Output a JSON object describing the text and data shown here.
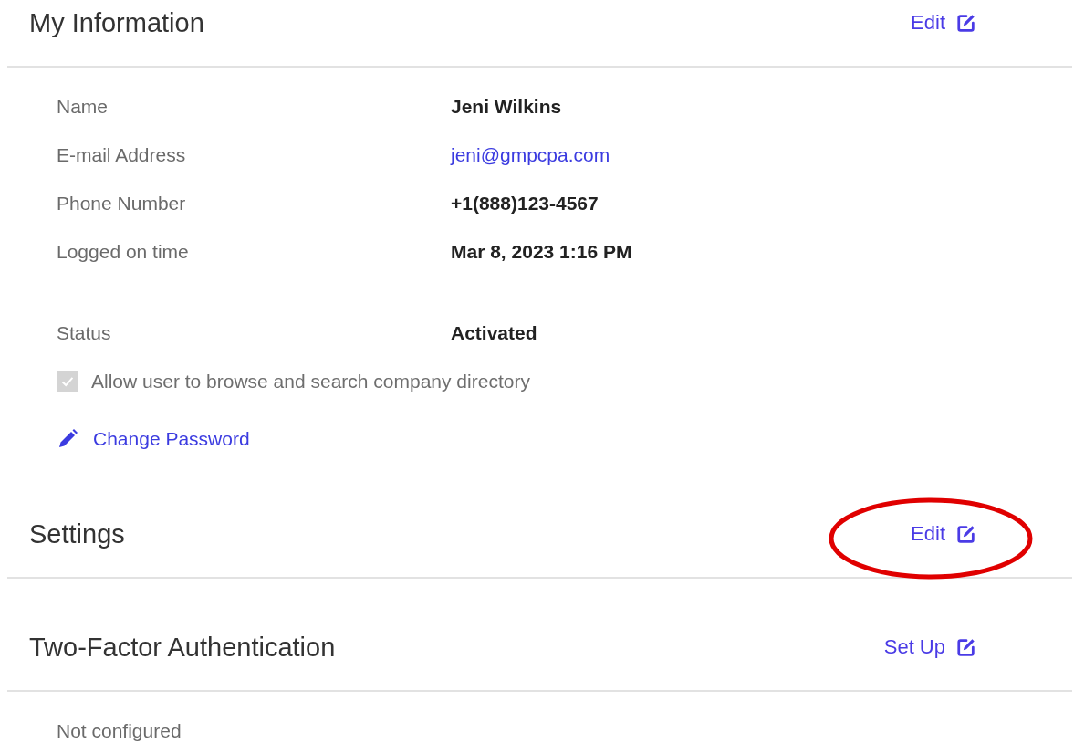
{
  "sections": [
    {
      "title": "My Information",
      "action": {
        "label": "Edit"
      },
      "fields": [
        {
          "label": "Name",
          "value": "Jeni Wilkins",
          "kind": "text"
        },
        {
          "label": "E-mail Address",
          "value": "jeni@gmpcpa.com",
          "kind": "link"
        },
        {
          "label": "Phone Number",
          "value": "+1(888)123-4567",
          "kind": "text"
        },
        {
          "label": "Logged on time",
          "value": "Mar 8, 2023 1:16 PM",
          "kind": "text"
        }
      ],
      "status": {
        "label": "Status",
        "value": "Activated"
      },
      "checkbox": {
        "label": "Allow user to browse and search company directory",
        "checked": true,
        "disabled": true
      },
      "link": {
        "label": "Change Password"
      }
    },
    {
      "title": "Settings",
      "action": {
        "label": "Edit"
      },
      "highlighted": true
    },
    {
      "title": "Two-Factor Authentication",
      "action": {
        "label": "Set Up"
      },
      "note": "Not configured"
    }
  ]
}
